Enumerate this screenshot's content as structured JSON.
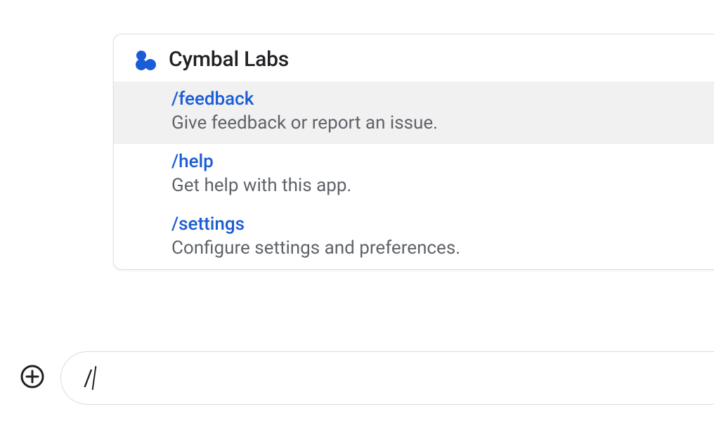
{
  "app": {
    "name": "Cymbal Labs",
    "icon_color": "#1a5cd6"
  },
  "commands": [
    {
      "name": "/feedback",
      "description": "Give feedback or report an issue.",
      "highlighted": true
    },
    {
      "name": "/help",
      "description": "Get help with this app.",
      "highlighted": false
    },
    {
      "name": "/settings",
      "description": "Configure settings and preferences.",
      "highlighted": false
    }
  ],
  "input": {
    "value": "/"
  }
}
